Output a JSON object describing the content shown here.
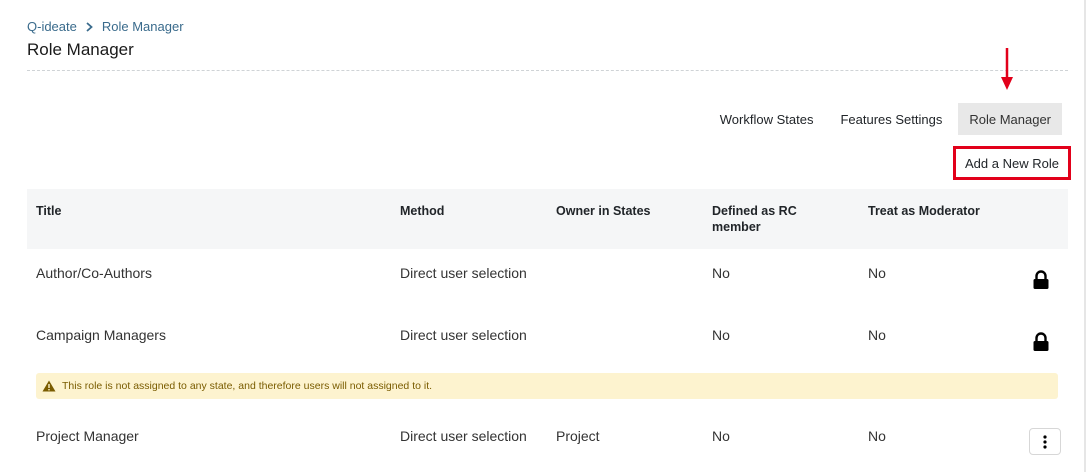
{
  "breadcrumb": {
    "root": "Q-ideate",
    "current": "Role Manager"
  },
  "page_title": "Role Manager",
  "tabs": [
    {
      "label": "Workflow States",
      "active": false
    },
    {
      "label": "Features Settings",
      "active": false
    },
    {
      "label": "Role Manager",
      "active": true
    }
  ],
  "add_role_label": "Add a New Role",
  "table": {
    "headers": {
      "title": "Title",
      "method": "Method",
      "owner": "Owner in States",
      "rc_member": "Defined as RC member",
      "moderator": "Treat as Moderator"
    },
    "rows": [
      {
        "title": "Author/Co-Authors",
        "method": "Direct user selection",
        "owner": "",
        "rc_member": "No",
        "moderator": "No",
        "action": "lock-icon"
      },
      {
        "title": "Campaign Managers",
        "method": "Direct user selection",
        "owner": "",
        "rc_member": "No",
        "moderator": "No",
        "action": "lock-icon"
      },
      {
        "title": "Project Manager",
        "method": "Direct user selection",
        "owner": "Project",
        "rc_member": "No",
        "moderator": "No",
        "action": "kebab-menu-icon"
      }
    ]
  },
  "warning_text": "This role is not assigned to any state, and therefore users will not assigned to it.",
  "colors": {
    "accent_red": "#e2001a",
    "link": "#3a6b8c",
    "warning_bg": "#fdf3cf"
  }
}
